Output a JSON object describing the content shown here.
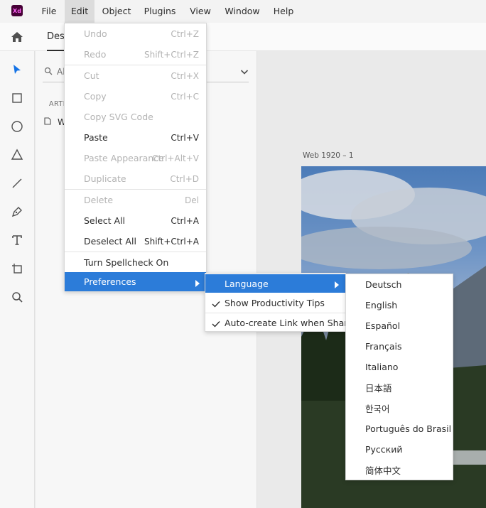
{
  "app": {
    "logo_text": "Xd",
    "logo_bg": "#470137",
    "logo_fg": "#ff61f6"
  },
  "menubar": {
    "items": [
      "File",
      "Edit",
      "Object",
      "Plugins",
      "View",
      "Window",
      "Help"
    ],
    "active": "Edit"
  },
  "topbar": {
    "home_icon": "home-icon",
    "tab_label": "Desi"
  },
  "toolbar": {
    "tools": [
      "select-arrow-icon",
      "rectangle-icon",
      "ellipse-icon",
      "triangle-icon",
      "line-icon",
      "pen-icon",
      "text-icon",
      "artboard-icon",
      "zoom-icon"
    ]
  },
  "layers": {
    "search_text": "Al",
    "section_label": "ARTI",
    "layer_label": "W"
  },
  "canvas": {
    "artboard_label": "Web 1920 – 1"
  },
  "edit_menu": {
    "items": [
      {
        "label": "Undo",
        "shortcut": "Ctrl+Z",
        "disabled": true
      },
      {
        "label": "Redo",
        "shortcut": "Shift+Ctrl+Z",
        "disabled": true
      },
      {
        "label": "Cut",
        "shortcut": "Ctrl+X",
        "disabled": true
      },
      {
        "label": "Copy",
        "shortcut": "Ctrl+C",
        "disabled": true
      },
      {
        "label": "Copy SVG Code",
        "shortcut": "",
        "disabled": true
      },
      {
        "label": "Paste",
        "shortcut": "Ctrl+V",
        "disabled": false
      },
      {
        "label": "Paste Appearance",
        "shortcut": "Ctrl+Alt+V",
        "disabled": true
      },
      {
        "label": "Duplicate",
        "shortcut": "Ctrl+D",
        "disabled": true
      },
      {
        "label": "Delete",
        "shortcut": "Del",
        "disabled": true
      },
      {
        "label": "Select All",
        "shortcut": "Ctrl+A",
        "disabled": false
      },
      {
        "label": "Deselect All",
        "shortcut": "Shift+Ctrl+A",
        "disabled": false
      },
      {
        "label": "Turn Spellcheck On",
        "shortcut": "",
        "disabled": false
      },
      {
        "label": "Preferences",
        "shortcut": "",
        "disabled": false,
        "highlighted": true,
        "submenu": true
      }
    ]
  },
  "preferences_menu": {
    "items": [
      {
        "label": "Language",
        "highlighted": true,
        "submenu": true,
        "checked": false
      },
      {
        "label": "Show Productivity Tips",
        "checked": true
      },
      {
        "label": "Auto-create Link when Sharing",
        "checked": true
      }
    ]
  },
  "language_menu": {
    "items": [
      "Deutsch",
      "English",
      "Español",
      "Français",
      "Italiano",
      "日本語",
      "한국어",
      "Português do Brasil",
      "Русский",
      "简体中文"
    ]
  },
  "colors": {
    "highlight": "#2c7cd9",
    "disabled_text": "#b3b3b3",
    "select_tool": "#1473e6"
  }
}
